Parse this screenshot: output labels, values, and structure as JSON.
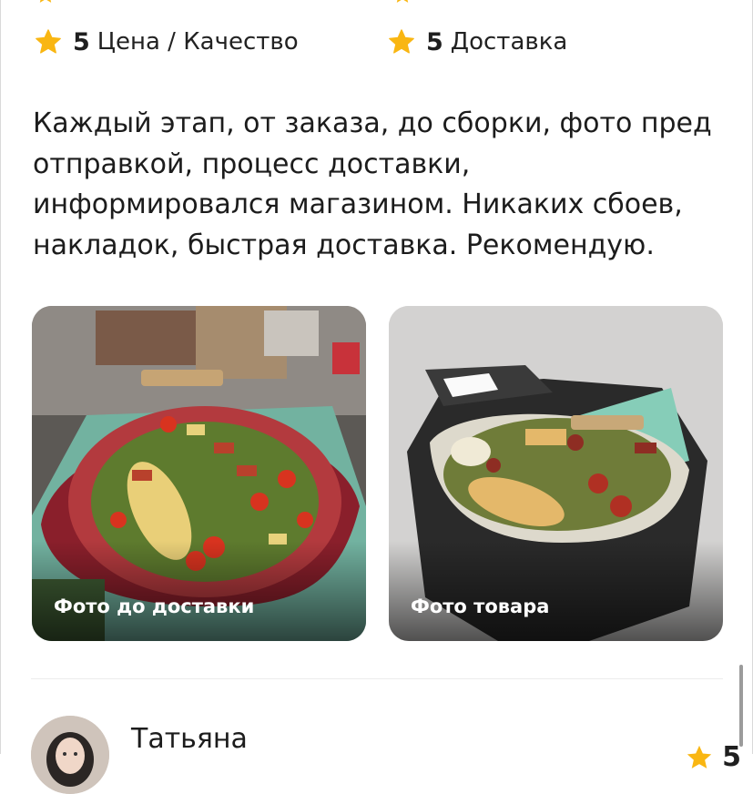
{
  "colors": {
    "star": "#f9b612",
    "text": "#1c1c1c",
    "divider": "#ececec"
  },
  "ratings": [
    {
      "score": "5",
      "label": "Цена / Качество",
      "icon": "star-icon"
    },
    {
      "score": "5",
      "label": "Доставка",
      "icon": "star-icon"
    }
  ],
  "review": {
    "lines": [
      "Каждый этап, от заказа, до сборки, фото пред",
      "отправкой, процесс доставки,",
      "информировался магазином. Никаких сбоев,",
      "накладок, быстрая доставка. Рекомендую."
    ]
  },
  "photos": [
    {
      "caption": "Фото до доставки"
    },
    {
      "caption": "Фото товара"
    }
  ],
  "next_review": {
    "name": "Татьяна",
    "score": "5",
    "icon": "star-icon"
  }
}
